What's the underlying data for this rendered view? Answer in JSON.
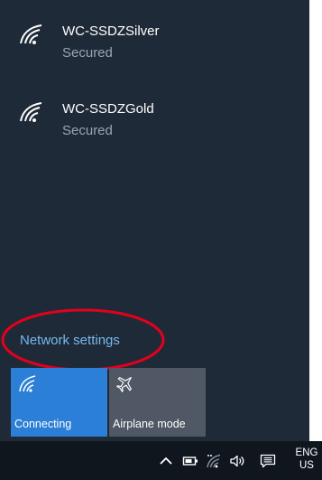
{
  "networks": [
    {
      "name": "WC-SSDZSilver",
      "status": "Secured",
      "icon": "wifi-secured-icon"
    },
    {
      "name": "WC-SSDZGold",
      "status": "Secured",
      "icon": "wifi-secured-icon"
    }
  ],
  "network_settings": {
    "label": "Network settings"
  },
  "tiles": {
    "connecting": {
      "label": "Connecting",
      "icon": "wifi-icon",
      "color": "#2b7fd6"
    },
    "airplane": {
      "label": "Airplane mode",
      "icon": "airplane-icon",
      "color": "#4f5864"
    }
  },
  "taskbar": {
    "language_line1": "ENG",
    "language_line2": "US",
    "icons": [
      "chevron-up-icon",
      "battery-icon",
      "wifi-connecting-icon",
      "volume-icon",
      "notifications-icon"
    ]
  },
  "colors": {
    "flyout_bg": "#1f2a38",
    "taskbar_bg": "#10161e",
    "link": "#76b9ed",
    "highlight": "#e4001b"
  }
}
